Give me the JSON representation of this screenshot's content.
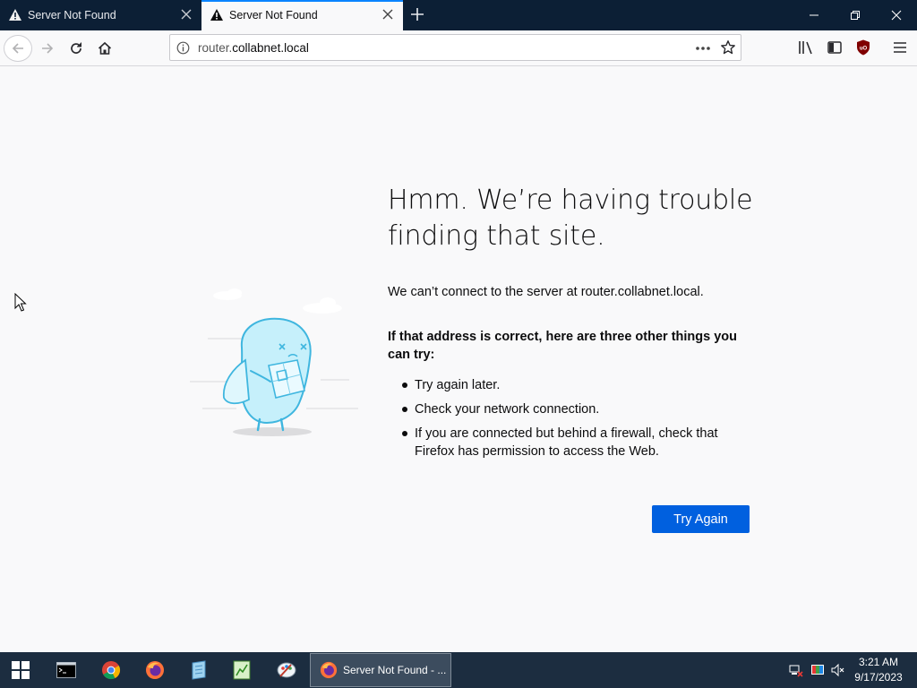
{
  "tabs": [
    {
      "title": "Server Not Found",
      "active": false
    },
    {
      "title": "Server Not Found",
      "active": true
    }
  ],
  "navbar": {
    "url_prefix": "router.",
    "url_host": "collabnet.local"
  },
  "error": {
    "title": "Hmm. We’re having trouble finding that site.",
    "description": "We can’t connect to the server at router.collabnet.local.",
    "suggestion_heading": "If that address is correct, here are three other things you can try:",
    "suggestions": [
      "Try again later.",
      "Check your network connection.",
      "If you are connected but behind a firewall, check that Firefox has permission to access the Web."
    ],
    "button_label": "Try Again"
  },
  "taskbar": {
    "active_app_label": "Server Not Found - ...",
    "time": "3:21 AM",
    "date": "9/17/2023"
  },
  "colors": {
    "accent": "#0a84ff",
    "button": "#0060df",
    "tabstrip": "#0c1f35",
    "taskbar": "#1c2d40"
  }
}
